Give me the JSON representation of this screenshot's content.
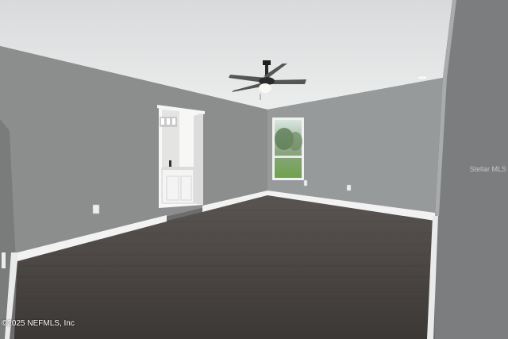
{
  "watermark": "Stellar MLS",
  "copyright": "©2025 NEFMLS, Inc",
  "colors": {
    "ceiling": "#e8e9ea",
    "wall_left": "#8b8d8c",
    "wall_back": "#96999a",
    "wall_right": "#7d7f80",
    "floor": "#4a4643",
    "baseboard": "#f3f3f3"
  }
}
